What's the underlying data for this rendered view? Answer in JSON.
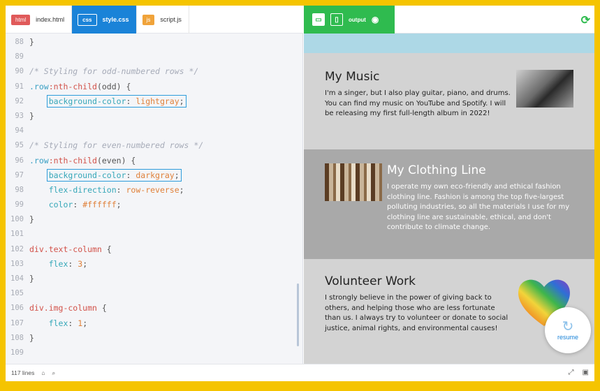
{
  "tabs": [
    {
      "badge": "html",
      "label": "index.html"
    },
    {
      "badge": "css",
      "label": "style.css"
    },
    {
      "badge": "js",
      "label": "script.js"
    }
  ],
  "code": {
    "l88": {
      "n": "88",
      "t": "}"
    },
    "l89": {
      "n": "89",
      "t": ""
    },
    "l90": {
      "n": "90",
      "t": "/* Styling for odd-numbered rows */"
    },
    "l91": {
      "n": "91",
      "sel": ".row",
      "pseudo": ":nth-child",
      "arg": "(odd)",
      "brace": " {"
    },
    "l92": {
      "n": "92",
      "prop": "background-color",
      "val": "lightgray"
    },
    "l93": {
      "n": "93",
      "t": "}"
    },
    "l94": {
      "n": "94",
      "t": ""
    },
    "l95": {
      "n": "95",
      "t": "/* Styling for even-numbered rows */"
    },
    "l96": {
      "n": "96",
      "sel": ".row",
      "pseudo": ":nth-child",
      "arg": "(even)",
      "brace": " {"
    },
    "l97": {
      "n": "97",
      "prop": "background-color",
      "val": "darkgray"
    },
    "l98": {
      "n": "98",
      "prop": "flex-direction",
      "val": "row-reverse"
    },
    "l99": {
      "n": "99",
      "prop": "color",
      "val": "#ffffff"
    },
    "l100": {
      "n": "100",
      "t": "}"
    },
    "l101": {
      "n": "101",
      "t": ""
    },
    "l102": {
      "n": "102",
      "sel": "div.text-column",
      "brace": " {"
    },
    "l103": {
      "n": "103",
      "prop": "flex",
      "val": "3"
    },
    "l104": {
      "n": "104",
      "t": "}"
    },
    "l105": {
      "n": "105",
      "t": ""
    },
    "l106": {
      "n": "106",
      "sel": "div.img-column",
      "brace": " {"
    },
    "l107": {
      "n": "107",
      "prop": "flex",
      "val": "1"
    },
    "l108": {
      "n": "108",
      "t": "}"
    },
    "l109": {
      "n": "109",
      "t": ""
    }
  },
  "status": {
    "lines": "117 lines"
  },
  "output": {
    "label": "output",
    "rows": [
      {
        "title": "My Music",
        "text": "I'm a singer, but I also play guitar, piano, and drums. You can find my music on YouTube and Spotify. I will be releasing my first full-length album in 2022!"
      },
      {
        "title": "My Clothing Line",
        "text": "I operate my own eco-friendly and ethical fashion clothing line. Fashion is among the top five-largest polluting industries, so all the materials I use for my clothing line are sustainable, ethical, and don't contribute to climate change."
      },
      {
        "title": "Volunteer Work",
        "text": "I strongly believe in the power of giving back to others, and helping those who are less fortunate than us. I always try to volunteer or donate to social justice, animal rights, and environmental causes!"
      }
    ]
  },
  "resume": {
    "label": "resume"
  }
}
